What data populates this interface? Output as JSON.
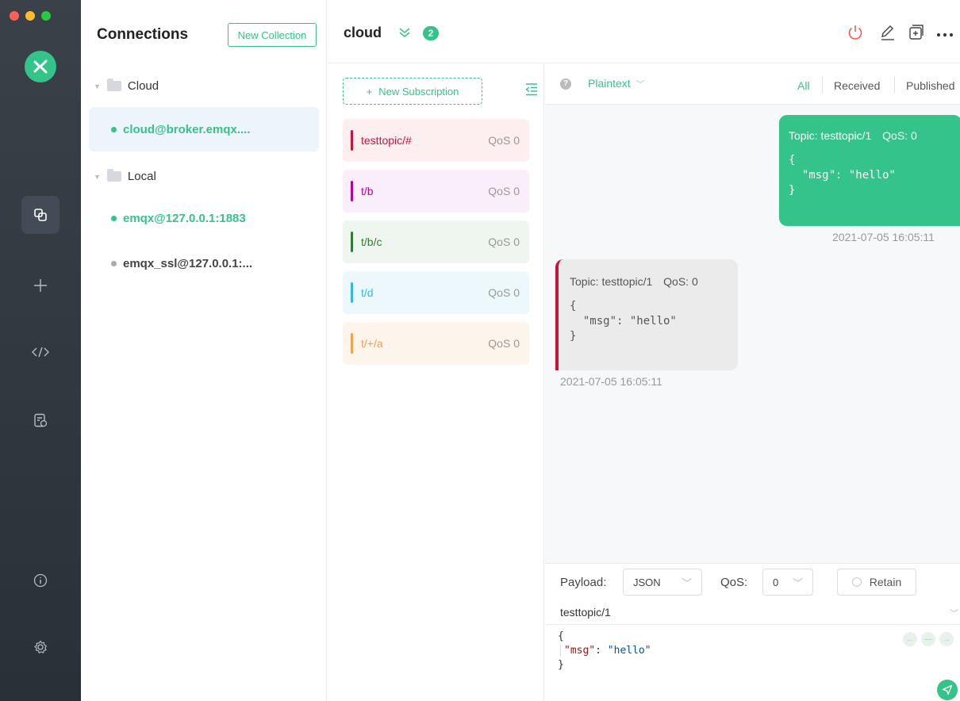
{
  "connections_panel": {
    "title": "Connections",
    "new_collection_label": "New Collection",
    "groups": [
      {
        "name": "Cloud",
        "items": [
          {
            "label": "cloud@broker.emqx....",
            "status": "connected"
          }
        ]
      },
      {
        "name": "Local",
        "items": [
          {
            "label": "emqx@127.0.0.1:1883",
            "status": "connected"
          },
          {
            "label": "emqx_ssl@127.0.0.1:...",
            "status": "disconnected"
          }
        ]
      }
    ]
  },
  "header": {
    "title": "cloud",
    "badge_count": "2",
    "icons": [
      "power-icon",
      "edit-icon",
      "new-window-icon",
      "more-icon"
    ]
  },
  "subscriptions": {
    "new_label": "New Subscription",
    "items": [
      {
        "topic": "testtopic/#",
        "qos": "QoS 0",
        "color": "#d0103a",
        "bg": "#fdeef0"
      },
      {
        "topic": "t/b",
        "qos": "QoS 0",
        "color": "#b4009e",
        "bg": "#fbeefb"
      },
      {
        "topic": "t/b/c",
        "qos": "QoS 0",
        "color": "#2e7d32",
        "bg": "#eef6ef"
      },
      {
        "topic": "t/d",
        "qos": "QoS 0",
        "color": "#34b8e6",
        "bg": "#edf8fc"
      },
      {
        "topic": "t/+/a",
        "qos": "QoS 0",
        "color": "#f0a24c",
        "bg": "#fdf4ec"
      }
    ]
  },
  "messages": {
    "format_label": "Plaintext",
    "filters": [
      "All",
      "Received",
      "Published"
    ],
    "sent": {
      "topic": "Topic: testtopic/1",
      "qos": "QoS: 0",
      "payload": "{\n  \"msg\": \"hello\"\n}",
      "time": "2021-07-05 16:05:11"
    },
    "received": {
      "topic": "Topic: testtopic/1",
      "qos": "QoS: 0",
      "payload": "{\n  \"msg\": \"hello\"\n}",
      "time": "2021-07-05 16:05:11"
    }
  },
  "composer": {
    "payload_label": "Payload:",
    "payload_format": "JSON",
    "qos_label": "QoS:",
    "qos_value": "0",
    "retain_label": "Retain",
    "topic": "testtopic/1",
    "payload_line1": "{",
    "payload_key": "\"msg\"",
    "payload_colon": ": ",
    "payload_value": "\"hello\"",
    "payload_line3": "}"
  },
  "colors": {
    "accent": "#34c388",
    "nav_bg": "#2f363e"
  }
}
